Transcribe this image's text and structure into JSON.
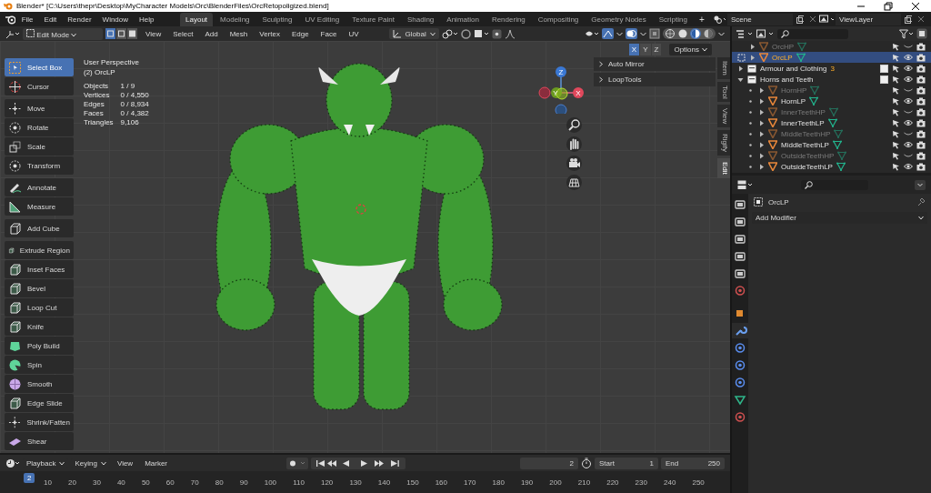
{
  "window": {
    "title": "Blender* [C:\\Users\\thepr\\Desktop\\MyCharacter Models\\Orc\\BlenderFiles\\OrcRetopoligized.blend]"
  },
  "menu": [
    "File",
    "Edit",
    "Render",
    "Window",
    "Help"
  ],
  "workspaces": [
    {
      "label": "Layout",
      "selected": true
    },
    {
      "label": "Modeling",
      "selected": false
    },
    {
      "label": "Sculpting",
      "selected": false
    },
    {
      "label": "UV Editing",
      "selected": false
    },
    {
      "label": "Texture Paint",
      "selected": false
    },
    {
      "label": "Shading",
      "selected": false
    },
    {
      "label": "Animation",
      "selected": false
    },
    {
      "label": "Rendering",
      "selected": false
    },
    {
      "label": "Compositing",
      "selected": false
    },
    {
      "label": "Geometry Nodes",
      "selected": false
    },
    {
      "label": "Scripting",
      "selected": false
    }
  ],
  "add_workspace": "+",
  "scene": "Scene",
  "view_layer": "ViewLayer",
  "viewport_header": {
    "mode": "Edit Mode",
    "select_modes": [
      {
        "selected": true
      },
      {
        "selected": false
      },
      {
        "selected": false
      }
    ],
    "menus": [
      "View",
      "Select",
      "Add",
      "Mesh",
      "Vertex",
      "Edge",
      "Face",
      "UV"
    ],
    "orientation": "Global",
    "shading": [
      {
        "selected": false
      },
      {
        "selected": false
      },
      {
        "selected": true
      },
      {
        "selected": false
      }
    ],
    "mirror_axes": [
      {
        "label": "X",
        "on": true
      },
      {
        "label": "Y",
        "on": false
      },
      {
        "label": "Z",
        "on": false
      }
    ],
    "options": "Options"
  },
  "overlay": {
    "view_name": "User Perspective",
    "object_name": "(2) OrcLP",
    "stats": [
      {
        "label": "Objects",
        "value": "1 / 9"
      },
      {
        "label": "Vertices",
        "value": "0 / 4,550"
      },
      {
        "label": "Edges",
        "value": "0 / 8,934"
      },
      {
        "label": "Faces",
        "value": "0 / 4,382"
      },
      {
        "label": "Triangles",
        "value": "9,106"
      }
    ]
  },
  "tool_groups": [
    [
      {
        "label": "Select Box",
        "kind": "select",
        "selected": true
      },
      {
        "label": "Cursor",
        "kind": "cursor",
        "selected": false
      }
    ],
    [
      {
        "label": "Move",
        "kind": "move",
        "selected": false
      },
      {
        "label": "Rotate",
        "kind": "rotate",
        "selected": false
      },
      {
        "label": "Scale",
        "kind": "scale",
        "selected": false
      },
      {
        "label": "Transform",
        "kind": "transform",
        "selected": false
      }
    ],
    [
      {
        "label": "Annotate",
        "kind": "annotate",
        "selected": false
      },
      {
        "label": "Measure",
        "kind": "measure",
        "selected": false
      }
    ],
    [
      {
        "label": "Add Cube",
        "kind": "cube",
        "selected": false
      }
    ],
    [
      {
        "label": "Extrude Region",
        "kind": "extrude",
        "selected": false
      },
      {
        "label": "Inset Faces",
        "kind": "inset",
        "selected": false
      },
      {
        "label": "Bevel",
        "kind": "bevel",
        "selected": false
      },
      {
        "label": "Loop Cut",
        "kind": "loopcut",
        "selected": false
      },
      {
        "label": "Knife",
        "kind": "knife",
        "selected": false
      },
      {
        "label": "Poly Build",
        "kind": "polybuild",
        "selected": false
      },
      {
        "label": "Spin",
        "kind": "spin",
        "selected": false
      },
      {
        "label": "Smooth",
        "kind": "smooth",
        "selected": false
      },
      {
        "label": "Edge Slide",
        "kind": "slide",
        "selected": false
      },
      {
        "label": "Shrink/Fatten",
        "kind": "shrink",
        "selected": false
      },
      {
        "label": "Shear",
        "kind": "shear",
        "selected": false
      }
    ]
  ],
  "gizmo": {
    "x": "X",
    "y": "Y",
    "z": "Z"
  },
  "side_panels": [
    {
      "label": "Auto Mirror",
      "expanded": false
    },
    {
      "label": "LoopTools",
      "expanded": false
    }
  ],
  "side_tabs": [
    {
      "label": "Item",
      "selected": false
    },
    {
      "label": "Tool",
      "selected": false
    },
    {
      "label": "View",
      "selected": false
    },
    {
      "label": "Rigify",
      "selected": false
    },
    {
      "label": "Edit",
      "selected": true
    }
  ],
  "outliner": {
    "rows": [
      {
        "name": "OrcHP",
        "kind": "object",
        "expanded": false,
        "visible": false,
        "selected": false
      },
      {
        "name": "OrcLP",
        "kind": "object",
        "expanded": false,
        "visible": true,
        "selected": true
      },
      {
        "name": "Armour and Clothing",
        "kind": "collection",
        "expanded": false,
        "checked": true,
        "badge": "3",
        "visible": true,
        "selected": false
      },
      {
        "name": "Horns and Teeth",
        "kind": "collection",
        "expanded": true,
        "checked": true,
        "visible": true,
        "selected": false,
        "children": [
          {
            "name": "HornHP",
            "kind": "object",
            "expanded": false,
            "visible": false,
            "selected": false
          },
          {
            "name": "HornLP",
            "kind": "object",
            "expanded": false,
            "visible": true,
            "selected": false
          },
          {
            "name": "InnerTeethHP",
            "kind": "object",
            "expanded": false,
            "visible": false,
            "selected": false
          },
          {
            "name": "InnerTeethLP",
            "kind": "object",
            "expanded": false,
            "visible": true,
            "selected": false
          },
          {
            "name": "MiddleTeethHP",
            "kind": "object",
            "expanded": false,
            "visible": false,
            "selected": false
          },
          {
            "name": "MiddleTeethLP",
            "kind": "object",
            "expanded": false,
            "visible": true,
            "selected": false
          },
          {
            "name": "OutsideTeethHP",
            "kind": "object",
            "expanded": false,
            "visible": false,
            "selected": false
          },
          {
            "name": "OutsideTeethLP",
            "kind": "object",
            "expanded": false,
            "visible": true,
            "selected": false
          }
        ]
      }
    ]
  },
  "properties": {
    "tabs": [
      {
        "selected": false
      },
      {
        "selected": false
      },
      {
        "selected": false
      },
      {
        "selected": false
      },
      {
        "selected": false
      },
      {
        "selected": false
      },
      {
        "selected": false
      },
      {
        "selected": true
      },
      {
        "selected": false
      },
      {
        "selected": false
      },
      {
        "selected": false
      },
      {
        "selected": false
      },
      {
        "selected": false
      }
    ],
    "object_name": "OrcLP",
    "add_modifier": "Add Modifier"
  },
  "timeline": {
    "menus": [
      "Playback",
      "Keying",
      "View",
      "Marker"
    ],
    "current_frame": "2",
    "start_label": "Start",
    "start": "1",
    "end_label": "End",
    "end": "250",
    "ruler_current": "2",
    "ruler_ticks": [
      "10",
      "20",
      "30",
      "40",
      "50",
      "60",
      "70",
      "80",
      "90",
      "100",
      "110",
      "120",
      "130",
      "140",
      "150",
      "160",
      "170",
      "180",
      "190",
      "200",
      "210",
      "220",
      "230",
      "240",
      "250"
    ]
  }
}
